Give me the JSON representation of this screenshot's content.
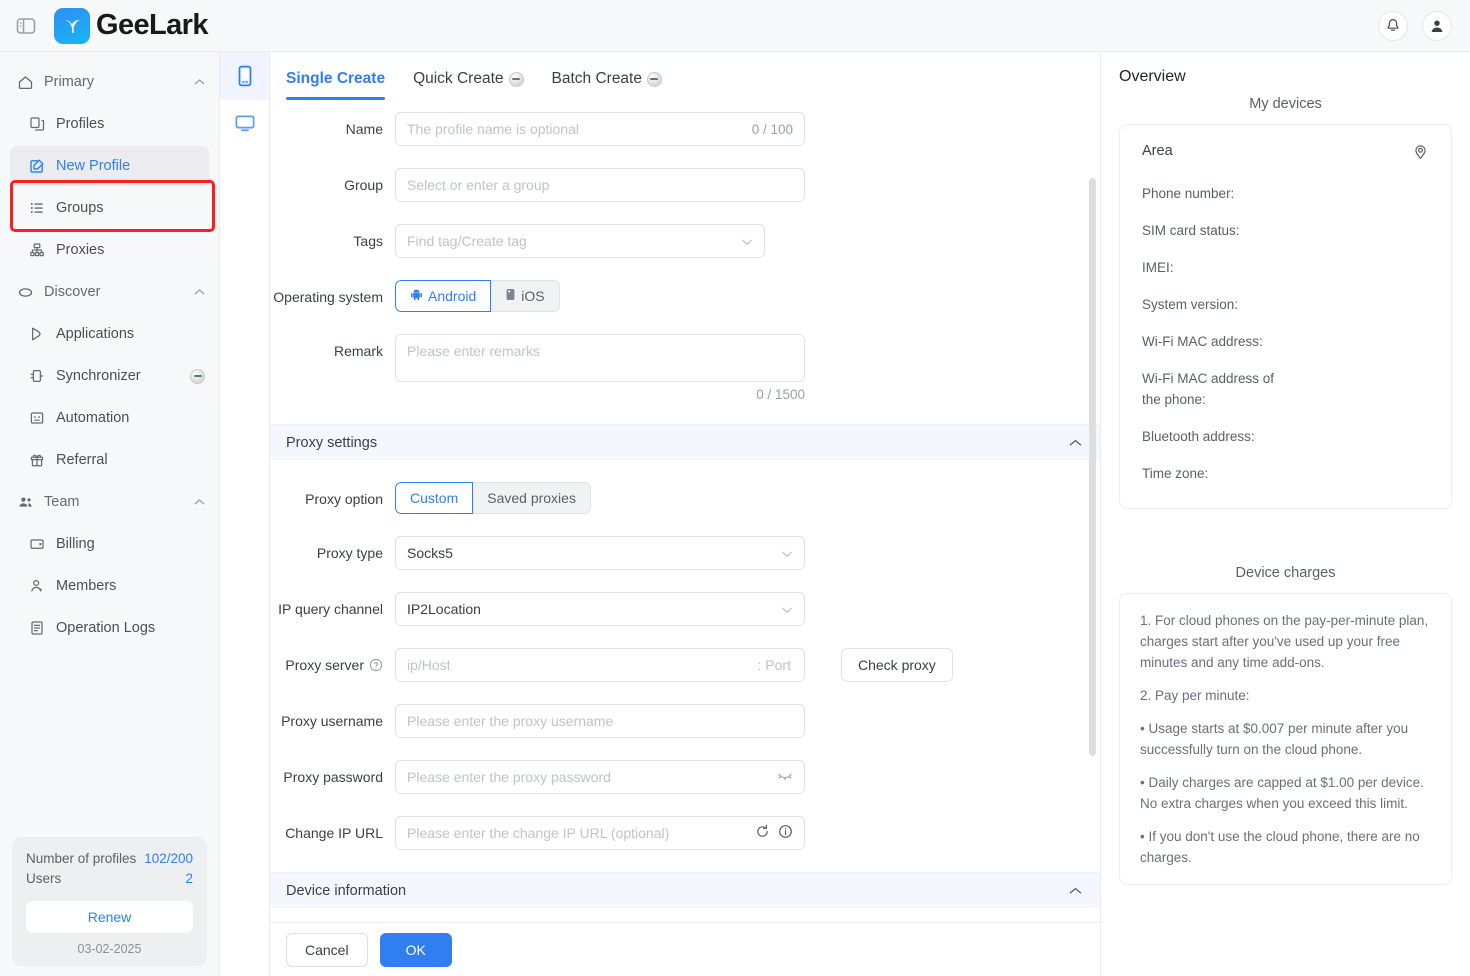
{
  "header": {
    "panel_toggle": "panel-toggle",
    "logo_text": "GeeLark",
    "notifications": "bell-icon",
    "account": "user-avatar-icon"
  },
  "sidebar": {
    "groups": [
      {
        "label": "Primary",
        "icon": "home-icon",
        "expanded": true,
        "items": [
          {
            "label": "Profiles",
            "icon": "profiles-icon",
            "active": false
          },
          {
            "label": "New Profile",
            "icon": "edit-square-icon",
            "active": true,
            "highlighted": true
          },
          {
            "label": "Groups",
            "icon": "list-icon",
            "active": false
          },
          {
            "label": "Proxies",
            "icon": "proxy-network-icon",
            "active": false
          }
        ]
      },
      {
        "label": "Discover",
        "icon": "cloud-icon",
        "expanded": true,
        "items": [
          {
            "label": "Applications",
            "icon": "applications-icon",
            "active": false
          },
          {
            "label": "Synchronizer",
            "icon": "synchronizer-icon",
            "active": false,
            "badge": "broken-image-badge"
          },
          {
            "label": "Automation",
            "icon": "automation-icon",
            "active": false
          },
          {
            "label": "Referral",
            "icon": "gift-icon",
            "active": false
          }
        ]
      },
      {
        "label": "Team",
        "icon": "team-icon",
        "expanded": true,
        "items": [
          {
            "label": "Billing",
            "icon": "billing-card-icon",
            "active": false
          },
          {
            "label": "Members",
            "icon": "member-icon",
            "active": false
          },
          {
            "label": "Operation Logs",
            "icon": "logs-icon",
            "active": false
          }
        ]
      }
    ],
    "plan": {
      "profiles_label": "Number of profiles",
      "profiles_value": "102/200",
      "users_label": "Users",
      "users_value": "2",
      "renew_label": "Renew",
      "date": "03-02-2025"
    }
  },
  "rail": {
    "items": [
      {
        "name": "phone-device-icon",
        "active": true
      },
      {
        "name": "desktop-device-icon",
        "active": false
      }
    ]
  },
  "main": {
    "tabs": [
      {
        "label": "Single Create",
        "active": true,
        "badge": false
      },
      {
        "label": "Quick Create",
        "active": false,
        "badge": true
      },
      {
        "label": "Batch Create",
        "active": false,
        "badge": true
      }
    ],
    "form": {
      "name_label": "Name",
      "name_placeholder": "The profile name is optional",
      "name_counter": "0 / 100",
      "group_label": "Group",
      "group_placeholder": "Select or enter a group",
      "tags_label": "Tags",
      "tags_placeholder": "Find tag/Create tag",
      "os_label": "Operating system",
      "os_android": "Android",
      "os_ios": "iOS",
      "os_selected": "Android",
      "remark_label": "Remark",
      "remark_placeholder": "Please enter remarks",
      "remark_counter": "0 / 1500"
    },
    "proxy_section": {
      "title": "Proxy settings",
      "option_label": "Proxy option",
      "option_custom": "Custom",
      "option_saved": "Saved proxies",
      "option_selected": "Custom",
      "type_label": "Proxy type",
      "type_value": "Socks5",
      "channel_label": "IP query channel",
      "channel_value": "IP2Location",
      "server_label": "Proxy server",
      "server_placeholder": "ip/Host",
      "server_port_placeholder": ": Port",
      "check_proxy_label": "Check proxy",
      "username_label": "Proxy username",
      "username_placeholder": "Please enter the proxy username",
      "password_label": "Proxy password",
      "password_placeholder": "Please enter the proxy password",
      "changeip_label": "Change IP URL",
      "changeip_placeholder": "Please enter the change IP URL (optional)"
    },
    "device_section": {
      "title": "Device information"
    },
    "footer": {
      "cancel": "Cancel",
      "ok": "OK"
    }
  },
  "overview": {
    "title": "Overview",
    "my_devices": "My devices",
    "area_label": "Area",
    "location_icon": "map-pin-icon",
    "fields": [
      "Phone number:",
      "SIM card status:",
      "IMEI:",
      "System version:",
      "Wi-Fi MAC address:",
      "Wi-Fi MAC address of the phone:",
      "Bluetooth address:",
      "Time zone:"
    ],
    "charges_title": "Device charges",
    "charges": [
      "1. For cloud phones on the pay-per-minute plan, charges start after you've used up your free minutes and any time add-ons.",
      "2. Pay per minute:",
      "• Usage starts at $0.007 per minute after you successfully turn on the cloud phone.",
      "• Daily charges are capped at $1.00 per device. No extra charges when you exceed this limit.",
      "• If you don't use the cloud phone, there are no charges."
    ]
  },
  "colors": {
    "accent": "#2f7ff0",
    "highlight": "#fb1e1e",
    "sidebar_bg": "#f7f8fa"
  }
}
